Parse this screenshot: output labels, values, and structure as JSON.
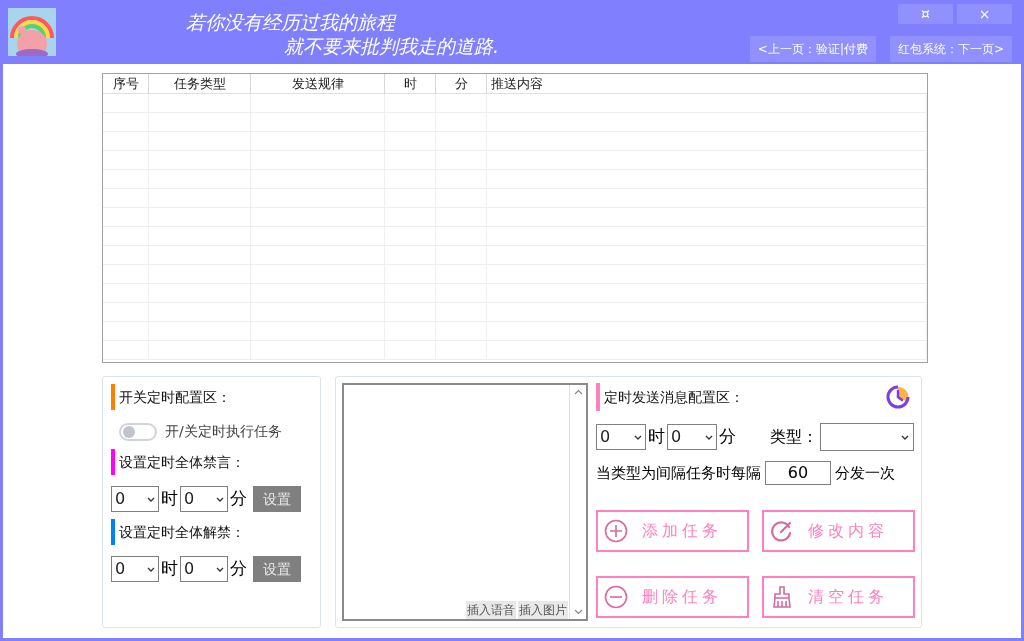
{
  "title_bar": {
    "motto_lines": [
      "若你没有经历过我的旅程",
      "就不要来批判我走的道路."
    ],
    "window_buttons": [
      "¤",
      "×"
    ],
    "nav_buttons": [
      "<上一页：验证|付费",
      "红包系统：下一页>"
    ]
  },
  "table": {
    "columns": [
      "序号",
      "任务类型",
      "发送规律",
      "时",
      "分",
      "推送内容"
    ]
  },
  "timer_panel": {
    "sections": [
      {
        "kind": "switch",
        "title": "开关定时配置区：",
        "color": "#ff8000",
        "switch": {
          "label": "开/关定时执行任务",
          "on": false
        }
      },
      {
        "kind": "time",
        "title": "设置定时全体禁言：",
        "color": "#ff00ff",
        "hour": "0",
        "hour_unit": "时",
        "minute": "0",
        "minute_unit": "分",
        "button": "设置"
      },
      {
        "kind": "time",
        "title": "设置定时全体解禁：",
        "color": "#0080ff",
        "hour": "0",
        "hour_unit": "时",
        "minute": "0",
        "minute_unit": "分",
        "button": "设置"
      }
    ]
  },
  "content_editor": {
    "buttons": [
      "插入语音",
      "插入图片"
    ]
  },
  "message_panel": {
    "title": "定时发送消息配置区：",
    "color": "#ff80c0",
    "hour": "0",
    "hour_unit": "时",
    "minute": "0",
    "minute_unit": "分",
    "type_label": "类型：",
    "interval_label": "当类型为间隔任务时每隔",
    "interval_value": "60",
    "interval_unit": "分发一次",
    "actions": [
      {
        "kind": "add",
        "label": "添加任务"
      },
      {
        "kind": "edit",
        "label": "修改内容"
      },
      {
        "kind": "remove",
        "label": "删除任务"
      },
      {
        "kind": "clear",
        "label": "清空任务"
      }
    ]
  }
}
